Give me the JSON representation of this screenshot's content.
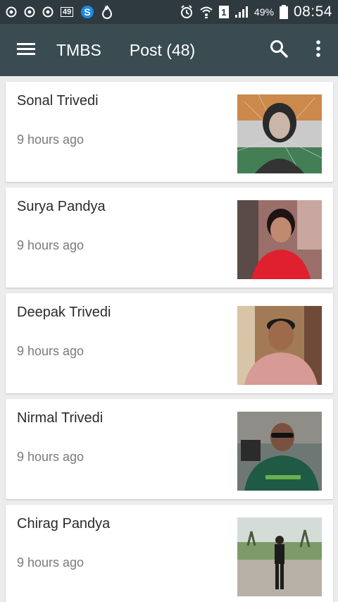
{
  "status_bar": {
    "badge": "49",
    "sim": "1",
    "battery": "49%",
    "time": "08:54",
    "icons": [
      "circle-icon",
      "circle-icon",
      "circle-icon",
      "notification-badge-icon",
      "s-logo-icon",
      "flame-icon",
      "alarm-icon",
      "wifi-icon",
      "sim-icon",
      "signal-icon",
      "battery-icon"
    ]
  },
  "app_bar": {
    "menu_icon": "hamburger-menu-icon",
    "title": "TMBS",
    "section": "Post (48)",
    "search_icon": "search-icon",
    "more_icon": "more-vertical-icon"
  },
  "posts": [
    {
      "name": "Sonal Trivedi",
      "time": "9 hours ago"
    },
    {
      "name": "Surya Pandya",
      "time": "9 hours ago"
    },
    {
      "name": "Deepak Trivedi",
      "time": "9 hours ago"
    },
    {
      "name": "Nirmal Trivedi",
      "time": "9 hours ago"
    },
    {
      "name": "Chirag Pandya",
      "time": "9 hours ago"
    }
  ]
}
